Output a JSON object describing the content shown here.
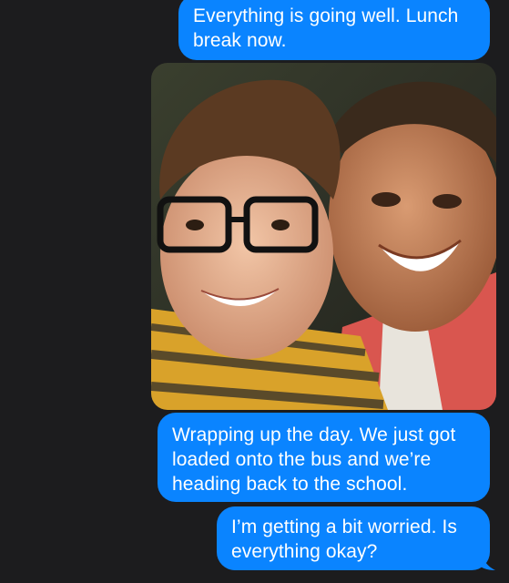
{
  "messages": [
    {
      "direction": "outgoing",
      "type": "text",
      "text": "Everything is going well. Lunch break now."
    },
    {
      "direction": "outgoing",
      "type": "photo"
    },
    {
      "direction": "outgoing",
      "type": "text",
      "text": "Wrapping up the day. We just got loaded onto the bus and we’re heading back to the school."
    },
    {
      "direction": "outgoing",
      "type": "text",
      "text": "I’m getting a bit worried. Is everything okay?"
    }
  ],
  "colors": {
    "background": "#1c1c1e",
    "outgoing_bubble": "#0a84ff",
    "bubble_text": "#ffffff"
  }
}
